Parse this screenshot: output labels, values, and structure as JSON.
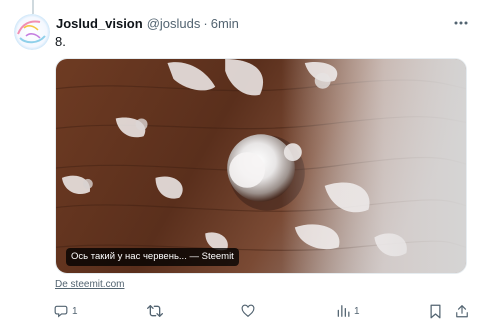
{
  "tweet": {
    "display_name": "Joslud_vision",
    "handle": "@josluds",
    "separator": "·",
    "timestamp": "6min",
    "text": "8.",
    "avatar_icon": "avatar-logo",
    "more_icon": "more-horizontal-icon"
  },
  "card": {
    "image_description": "water-droplet-on-wood",
    "title_chip": "Ось такий у нас червень... — Steemit",
    "source_link": "De steemit.com"
  },
  "actions": {
    "reply": {
      "icon": "reply-icon",
      "count": "1"
    },
    "retweet": {
      "icon": "retweet-icon",
      "count": ""
    },
    "like": {
      "icon": "like-icon",
      "count": ""
    },
    "views": {
      "icon": "views-icon",
      "count": "1"
    },
    "bookmark": {
      "icon": "bookmark-icon"
    },
    "share": {
      "icon": "share-icon"
    }
  },
  "colors": {
    "text_primary": "#0f1419",
    "text_secondary": "#536471",
    "border": "#e6ecf0",
    "wood": "#6b3a24"
  }
}
